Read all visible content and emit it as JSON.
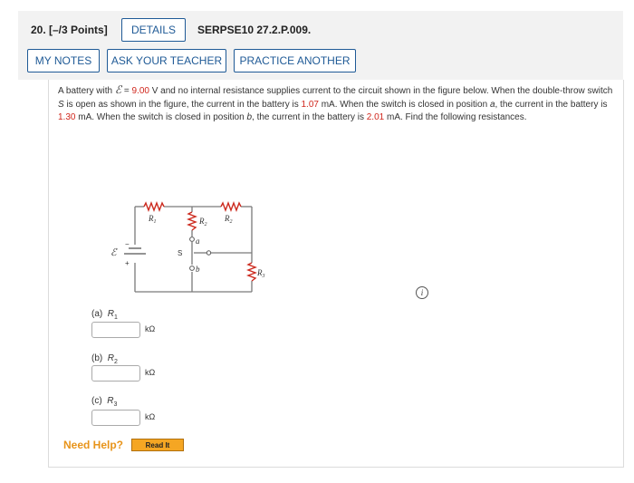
{
  "header": {
    "question_title": "20.  [–/3 Points]",
    "details_label": "DETAILS",
    "problem_ref": "SERPSE10 27.2.P.009.",
    "my_notes_label": "MY NOTES",
    "ask_teacher_label": "ASK YOUR TEACHER",
    "practice_label": "PRACTICE ANOTHER"
  },
  "problem": {
    "t1": "A battery with ",
    "emf_symbol": "ℰ",
    "t2": " = ",
    "emf_value": "9.00",
    "t3": " V and no internal resistance supplies current to the circuit shown in the figure below. When the double-throw switch ",
    "switch_symbol": "S",
    "t4": " is open as shown in the figure, the current in the battery is ",
    "i_open": "1.07",
    "t5": " mA. When the switch is closed in position ",
    "pos_a": "a",
    "t6": ", the current in the battery is ",
    "i_a": "1.30",
    "t7": " mA. When the switch is closed in position ",
    "pos_b": "b",
    "t8": ", the current in the battery is ",
    "i_b": "2.01",
    "t9": " mA. Find the following resistances."
  },
  "figure": {
    "r1": "R",
    "r1_sub": "1",
    "r2_mid": "R",
    "r2_mid_sub": "2",
    "r2_top": "R",
    "r2_top_sub": "2",
    "r3": "R",
    "r3_sub": "3",
    "emf": "ℰ",
    "minus": "−",
    "plus": "+",
    "switch": "S",
    "a": "a",
    "b": "b"
  },
  "info_icon": "i",
  "parts": [
    {
      "letter": "(a)",
      "var": "R",
      "sub": "1",
      "unit": "kΩ",
      "value": ""
    },
    {
      "letter": "(b)",
      "var": "R",
      "sub": "2",
      "unit": "kΩ",
      "value": ""
    },
    {
      "letter": "(c)",
      "var": "R",
      "sub": "3",
      "unit": "kΩ",
      "value": ""
    }
  ],
  "help": {
    "need_help": "Need Help?",
    "read_it": "Read It"
  },
  "colors": {
    "accent": "#1f5a96",
    "highlight_value": "#d0271d",
    "help_orange": "#e8941a",
    "resistor_red": "#cc2a1e",
    "wire_gray": "#7a7a7a"
  }
}
